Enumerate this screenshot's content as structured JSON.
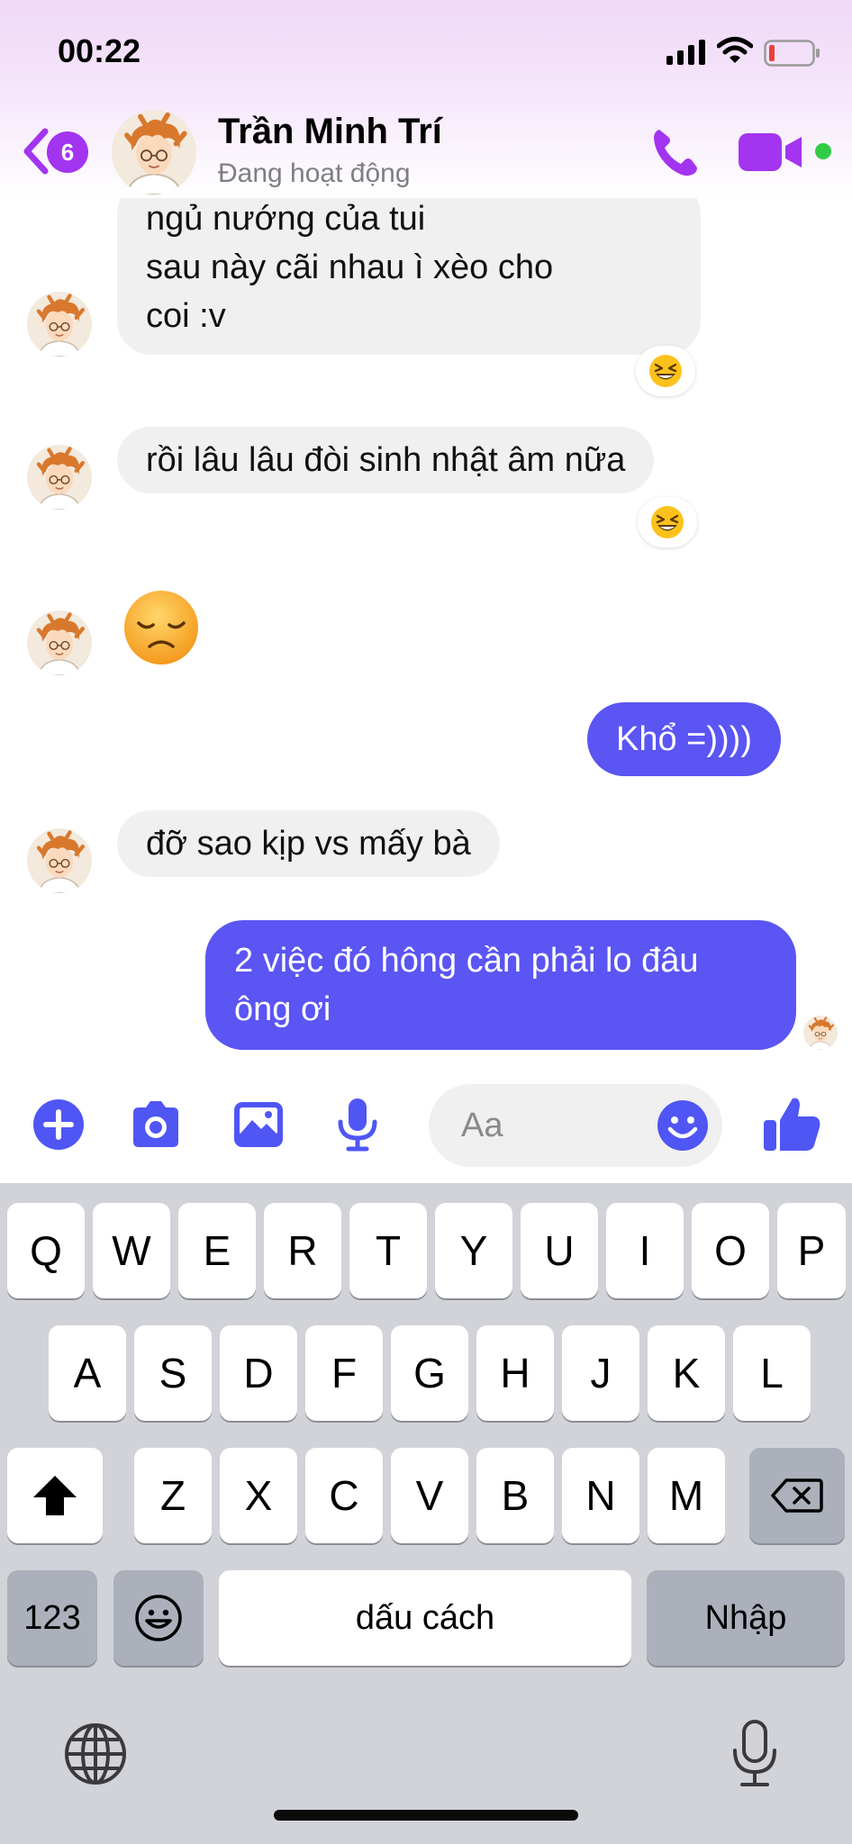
{
  "status_bar": {
    "time": "00:22"
  },
  "header": {
    "unread_count": "6",
    "contact_name": "Trần Minh Trí",
    "contact_status": "Đang hoạt động"
  },
  "messages": [
    {
      "sender": "them",
      "lines": [
        "ngủ nướng của tui",
        "sau này cãi nhau ì xèo cho",
        "coi :v"
      ],
      "reaction": "😆"
    },
    {
      "sender": "them",
      "text": "rồi lâu lâu đòi sinh nhật âm nữa",
      "reaction": "😆"
    },
    {
      "sender": "them",
      "emoji": "😞"
    },
    {
      "sender": "me",
      "text": "Khổ =))))"
    },
    {
      "sender": "them",
      "text": "đỡ sao kịp vs mấy bà"
    },
    {
      "sender": "me",
      "lines": [
        "2 việc đó hông cần phải lo đâu",
        "ông ơi"
      ]
    }
  ],
  "composer": {
    "placeholder": "Aa"
  },
  "keyboard": {
    "row1": [
      "Q",
      "W",
      "E",
      "R",
      "T",
      "Y",
      "U",
      "I",
      "O",
      "P"
    ],
    "row2": [
      "A",
      "S",
      "D",
      "F",
      "G",
      "H",
      "J",
      "K",
      "L"
    ],
    "row3": [
      "Z",
      "X",
      "C",
      "V",
      "B",
      "N",
      "M"
    ],
    "numbers_key": "123",
    "space_key": "dấu cách",
    "return_key": "Nhập"
  },
  "colors": {
    "accent": "#a334f0",
    "outgoing_bubble": "#5b55f3",
    "incoming_bubble": "#f0f0f0",
    "composer_icons": "#4f56f4",
    "online": "#31cc46"
  },
  "icons": [
    "back-chevron-icon",
    "phone-icon",
    "video-icon",
    "plus-icon",
    "camera-icon",
    "gallery-icon",
    "microphone-icon",
    "emoji-icon",
    "thumbs-up-icon",
    "shift-icon",
    "backspace-icon",
    "globe-icon",
    "dictation-icon"
  ]
}
